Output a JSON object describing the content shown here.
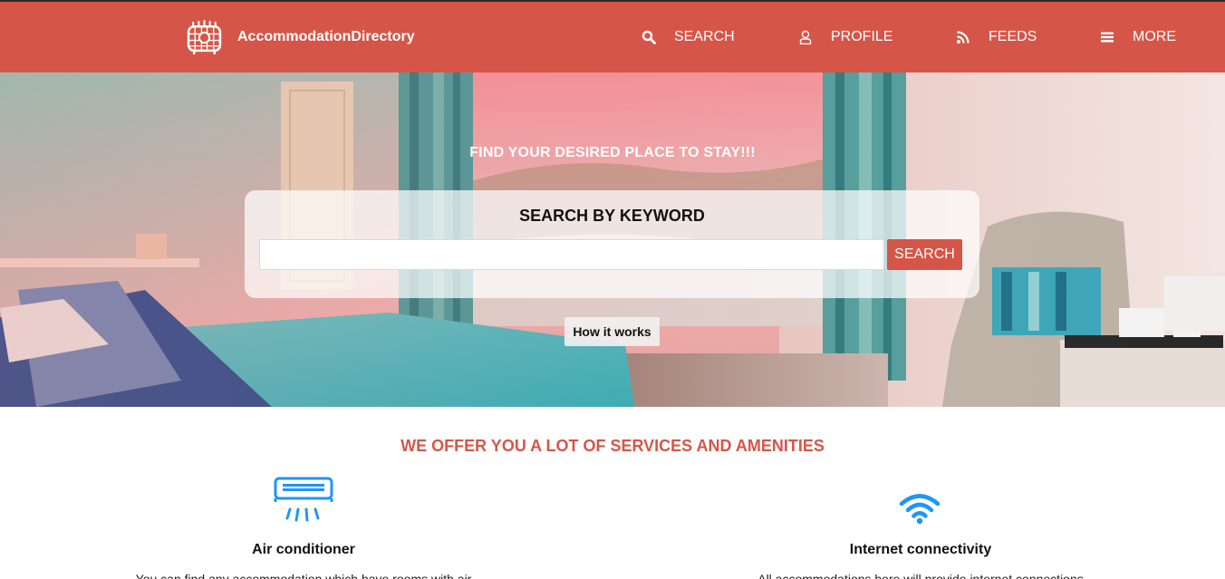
{
  "brand": {
    "name": "AccommodationDirectory",
    "logo_icon": "building-logo-icon"
  },
  "nav": {
    "items": [
      {
        "label": "SEARCH",
        "icon": "search-icon"
      },
      {
        "label": "PROFILE",
        "icon": "user-icon"
      },
      {
        "label": "FEEDS",
        "icon": "rss-icon"
      },
      {
        "label": "MORE",
        "icon": "menu-icon"
      }
    ]
  },
  "hero": {
    "tagline": "FIND YOUR DESIRED PLACE TO STAY!!!",
    "search_title": "SEARCH BY KEYWORD",
    "search_value": "",
    "search_placeholder": "",
    "search_button": "SEARCH",
    "how_button": "How it works"
  },
  "services": {
    "heading": "WE OFFER YOU A LOT OF SERVICES AND AMENITIES",
    "items": [
      {
        "title": "Air conditioner",
        "icon": "air-conditioner-icon",
        "description": "You can find any accommodation which have rooms with air"
      },
      {
        "title": "Internet connectivity",
        "icon": "wifi-icon",
        "description": "All accommodations here will provide internet connections"
      }
    ]
  },
  "colors": {
    "brand": "#d55648",
    "icon_blue": "#2196f3",
    "white": "#ffffff"
  }
}
